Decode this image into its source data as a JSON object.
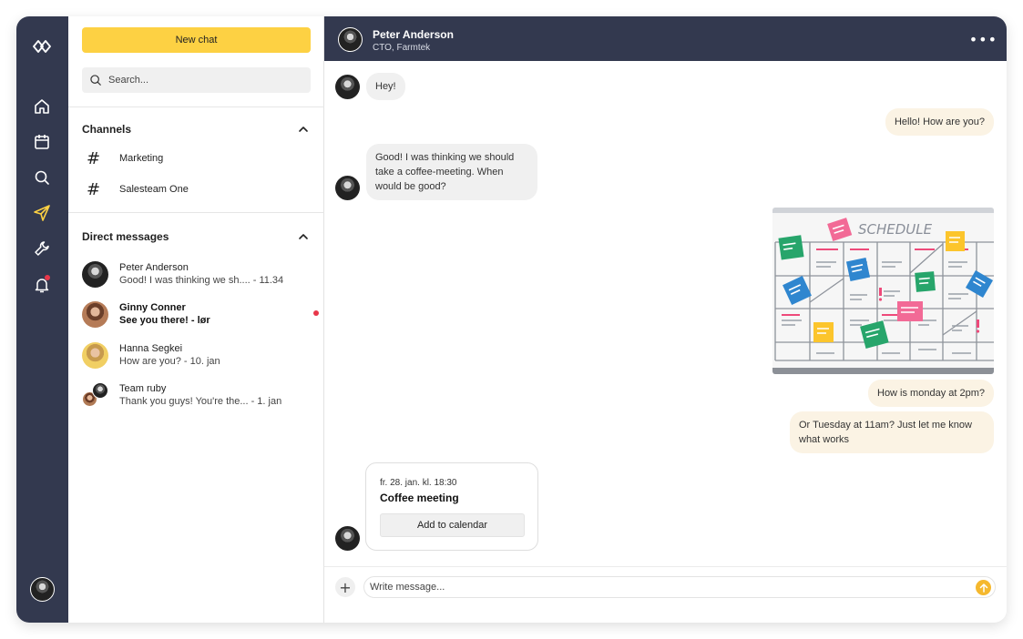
{
  "colors": {
    "rail": "#33394f",
    "accent": "#fdd143",
    "send": "#f5b82e",
    "unread_dot": "#e8374a",
    "outgoing_bubble": "#fbf3e4",
    "incoming_bubble": "#f0f0f0"
  },
  "rail": {
    "icons": [
      "logo-icon",
      "home-icon",
      "calendar-icon",
      "search-icon",
      "send-icon",
      "wrench-icon",
      "bell-icon"
    ],
    "active": "send-icon"
  },
  "sidebar": {
    "new_chat_label": "New chat",
    "search_placeholder": "Search...",
    "channels_title": "Channels",
    "channels": [
      {
        "label": "Marketing"
      },
      {
        "label": "Salesteam One"
      }
    ],
    "dm_title": "Direct messages",
    "dms": [
      {
        "name": "Peter Anderson",
        "preview": "Good! I was thinking we sh....  -  11.34",
        "unread": false
      },
      {
        "name": "Ginny Conner",
        "preview": "See you there!  -  lør",
        "unread": true
      },
      {
        "name": "Hanna Segkei",
        "preview": "How are you?  -  10. jan",
        "unread": false
      },
      {
        "name": "Team ruby",
        "preview": "Thank you guys! You're the...  -  1. jan",
        "unread": false
      }
    ]
  },
  "chat": {
    "contact_name": "Peter Anderson",
    "contact_role": "CTO, Farmtek",
    "messages": [
      {
        "from": "in",
        "text": "Hey!"
      },
      {
        "from": "out",
        "text": "Hello! How are you?"
      },
      {
        "from": "in",
        "text": "Good! I was thinking we should take a coffee-meeting. When would be good?"
      },
      {
        "from": "out",
        "type": "image",
        "caption": "SCHEDULE"
      },
      {
        "from": "out",
        "text": "How is monday at 2pm?"
      },
      {
        "from": "out",
        "text": "Or Tuesday at 11am? Just let me know what works"
      }
    ],
    "event": {
      "date": "fr. 28. jan. kl. 18:30",
      "title": "Coffee meeting",
      "button_label": "Add to calendar"
    },
    "composer_placeholder": "Write message..."
  }
}
